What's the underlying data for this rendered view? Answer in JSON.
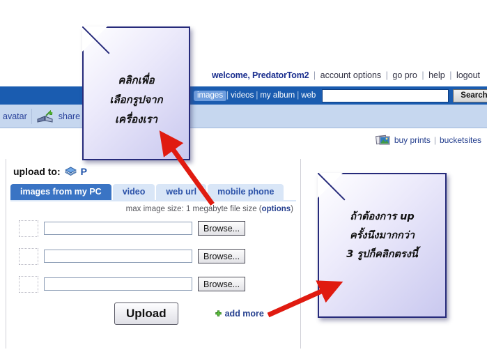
{
  "account_bar": {
    "welcome": "welcome, PredatorTom2",
    "links": [
      "account options",
      "go pro",
      "help",
      "logout"
    ],
    "separator": "|"
  },
  "nav": {
    "search_scopes": [
      "images",
      "videos",
      "my album",
      "web"
    ],
    "active_scope": "images",
    "search_value": "",
    "search_placeholder": "",
    "search_button": "Search",
    "scope_separator": "|"
  },
  "subnav": {
    "items": [
      {
        "label": "avatar",
        "icon": "avatar-icon"
      },
      {
        "label": "share",
        "icon": "share-book-icon"
      }
    ]
  },
  "prints_row": {
    "icon": "photos-icon",
    "links": [
      "buy prints",
      "bucketsites"
    ],
    "separator": "|"
  },
  "upload_panel": {
    "upload_to_label": "upload to:",
    "album_icon": "album-disc-icon",
    "album_name": "P",
    "tabs": [
      {
        "label": "images from my PC",
        "active": true
      },
      {
        "label": "video",
        "active": false
      },
      {
        "label": "web url",
        "active": false
      },
      {
        "label": "mobile phone",
        "active": false
      }
    ],
    "max_size_note": "max image size: 1 megabyte file size (",
    "options_link": "options",
    "max_size_note_end": ")",
    "file_rows": [
      {
        "value": "",
        "browse_label": "Browse..."
      },
      {
        "value": "",
        "browse_label": "Browse..."
      },
      {
        "value": "",
        "browse_label": "Browse..."
      }
    ],
    "upload_button": "Upload",
    "add_more_label": "add more",
    "add_more_icon": "green-plus-icon"
  },
  "notes": [
    {
      "id": "note-one",
      "lines": [
        "คลิกเพื่อ",
        "เลือกรูปจาก",
        "เครื่องเรา"
      ]
    },
    {
      "id": "note-two",
      "lines": [
        "ถ้าต้องการ up",
        "ครั้งนึงมากกว่า",
        "3 รูปก็คลิกตรงนี้"
      ]
    }
  ],
  "colors": {
    "nav_blue": "#1a5cb0",
    "subnav_blue": "#c6d7ef",
    "accent_link": "#26408f",
    "note_border": "#262a7a",
    "arrow_red": "#e01b10",
    "active_tab": "#3a74c4"
  }
}
